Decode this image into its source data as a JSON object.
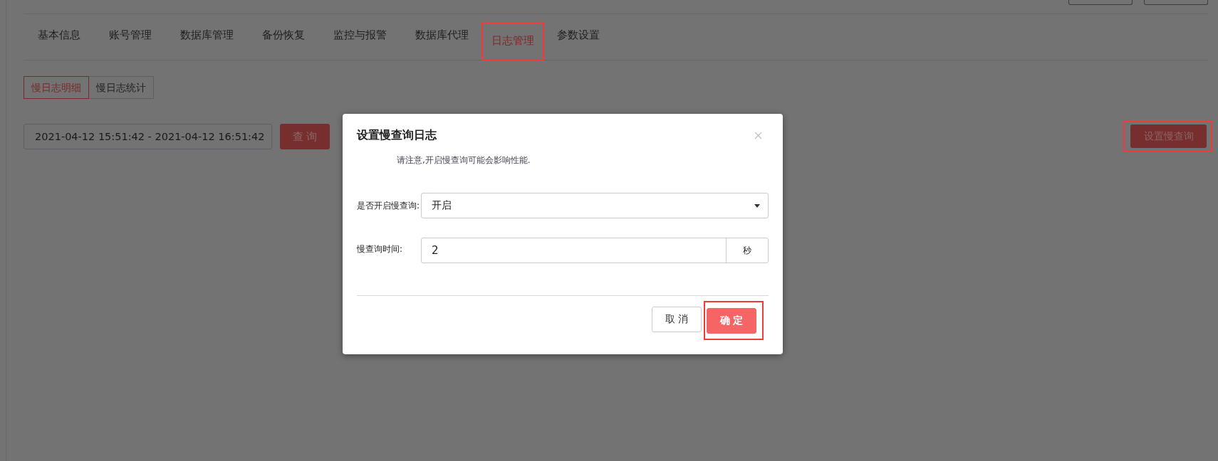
{
  "tabs": [
    {
      "label": "基本信息",
      "selected": false,
      "highlighted": false
    },
    {
      "label": "账号管理",
      "selected": false,
      "highlighted": false
    },
    {
      "label": "数据库管理",
      "selected": false,
      "highlighted": false
    },
    {
      "label": "备份恢复",
      "selected": false,
      "highlighted": false
    },
    {
      "label": "监控与报警",
      "selected": false,
      "highlighted": false
    },
    {
      "label": "数据库代理",
      "selected": false,
      "highlighted": false
    },
    {
      "label": "日志管理",
      "selected": true,
      "highlighted": true
    },
    {
      "label": "参数设置",
      "selected": false,
      "highlighted": false
    }
  ],
  "sub_tabs": [
    {
      "label": "慢日志明细",
      "selected": true
    },
    {
      "label": "慢日志统计",
      "selected": false
    }
  ],
  "date_range": {
    "value": "2021-04-12 15:51:42 - 2021-04-12 16:51:42"
  },
  "query_button": "查 询",
  "settings_button": {
    "label": "设置慢查询",
    "highlighted": true
  },
  "dialog": {
    "title": "设置慢查询日志",
    "notice": "请注意,开启慢查询可能会影响性能.",
    "fields": [
      {
        "kind": "select",
        "label": "是否开启慢查询:",
        "value": "开启"
      },
      {
        "kind": "number",
        "label": "慢查询时间:",
        "value": "2",
        "unit": "秒"
      }
    ],
    "buttons": [
      {
        "kind": "cancel",
        "label": "取 消",
        "highlighted": false
      },
      {
        "kind": "confirm",
        "label": "确 定",
        "highlighted": true
      }
    ]
  }
}
